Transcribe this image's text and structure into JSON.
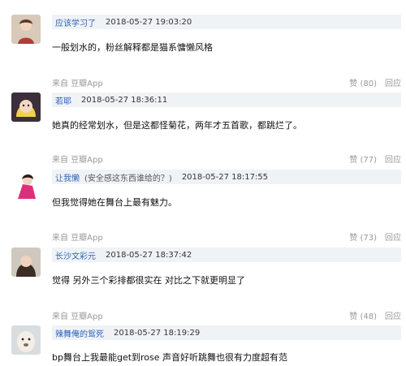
{
  "comments": [
    {
      "username": "应该学习了",
      "note": "",
      "time": "2018-05-27 19:03:20",
      "content": "一般划水的，粉丝解释都是猫系慵懒风格",
      "source": "来自 豆瓣App",
      "like": "赞 (80)",
      "reply": "回应"
    },
    {
      "username": "若耶",
      "note": "",
      "time": "2018-05-27 18:36:11",
      "content": "她真的经常划水，但是这都怪菊花，两年才五首歌，都跳烂了。",
      "source": "来自 豆瓣App",
      "like": "赞 (77)",
      "reply": "回应"
    },
    {
      "username": "让我懒",
      "note": "(安全感这东西谁给的？)",
      "time": "2018-05-27 18:17:55",
      "content": "但我觉得她在舞台上最有魅力。",
      "source": "来自 豆瓣App",
      "like": "赞 (73)",
      "reply": "回应"
    },
    {
      "username": "长沙文彩元",
      "note": "",
      "time": "2018-05-27 18:37:42",
      "content": "觉得 另外三个彩排都很实在 对比之下就更明显了",
      "source": "来自 豆瓣App",
      "like": "赞 (48)",
      "reply": "回应"
    },
    {
      "username": "辣舞俺的鸳死",
      "note": "",
      "time": "2018-05-27 18:19:29",
      "content": "bp舞台上我最能get到rose 声音好听跳舞也很有力度超有范",
      "source": "",
      "like": "",
      "reply": ""
    }
  ],
  "colors": {
    "username": "#2e64b8",
    "header_bg": "#f0f3f5",
    "meta": "#999999"
  }
}
